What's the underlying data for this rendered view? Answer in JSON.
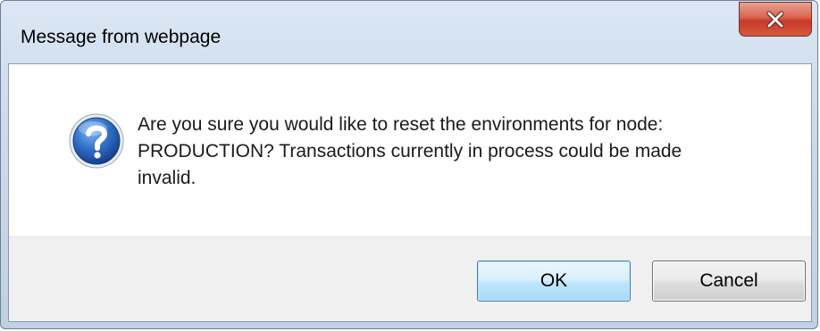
{
  "window": {
    "title": "Message from webpage",
    "close_icon": "close-icon"
  },
  "dialog": {
    "icon": "question-icon",
    "message_lines": [
      "Are you sure you would like to reset the environments for node:",
      "PRODUCTION?  Transactions currently in process could be made",
      "invalid."
    ]
  },
  "buttons": {
    "ok_label": "OK",
    "cancel_label": "Cancel"
  },
  "colors": {
    "close_button": "#c8392a",
    "ok_border": "#3c7fb1",
    "question_icon": "#1f5fb4"
  }
}
